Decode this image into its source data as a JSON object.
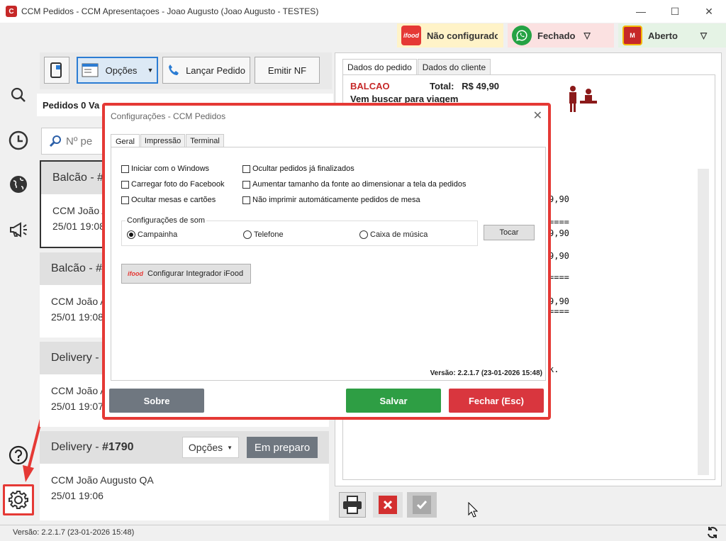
{
  "window": {
    "title": "CCM Pedidos - CCM Apresentaçoes - Joao Augusto (Joao Augusto - TESTES)",
    "minimize": "—",
    "maximize": "☐",
    "close": "✕"
  },
  "status": {
    "ifood": {
      "label": "Não configurado",
      "icon": "ifood",
      "color": "#fff3c8"
    },
    "whatsapp": {
      "label": "Fechado",
      "color": "#fbe1e1"
    },
    "store": {
      "label": "Aberto",
      "color": "#e5f3e5"
    }
  },
  "toolbar": {
    "options_label": "Opções",
    "launch_label": "Lançar Pedido",
    "emit_label": "Emitir NF"
  },
  "orders": {
    "header": "Pedidos 0 Va",
    "search_placeholder": "Nº pe",
    "cards": [
      {
        "title": "Balcão - #",
        "customer": "CCM João A",
        "time": "25/01 19:08"
      },
      {
        "title": "Balcão - #",
        "customer": "CCM João A",
        "time": "25/01 19:08"
      },
      {
        "title": "Delivery -",
        "customer": "CCM João A",
        "time": "25/01 19:07"
      },
      {
        "title_prefix": "Delivery - ",
        "title_num": "#1790",
        "customer": "CCM João Augusto QA",
        "time": "25/01 19:06",
        "options": "Opções",
        "status": "Em preparo"
      }
    ]
  },
  "detail": {
    "tabs": [
      "Dados do pedido",
      "Dados do cliente"
    ],
    "type": "BALCAO",
    "total_label": "Total:",
    "total_value": "R$ 49,90",
    "note": "Vem buscar para viagem",
    "receipt_lines": [
      "9,90",
      "====",
      "9,90",
      "9,90",
      "====",
      "9,90",
      "====",
      "k."
    ]
  },
  "dialog": {
    "title": "Configurações - CCM Pedidos",
    "tabs": [
      "Geral",
      "Impressão",
      "Terminal"
    ],
    "checkboxes": {
      "start_windows": "Iniciar com o Windows",
      "facebook_photo": "Carregar foto do Facebook",
      "hide_tables": "Ocultar mesas e cartões",
      "hide_finished": "Ocultar pedidos já finalizados",
      "increase_font": "Aumentar tamanho da fonte ao dimensionar a tela da pedidos",
      "no_print_table": "Não imprimir automáticamente pedidos de mesa"
    },
    "sound_group": "Configurações de som",
    "sounds": [
      "Campainha",
      "Telefone",
      "Caixa de música"
    ],
    "play_label": "Tocar",
    "ifood_logo": "ifood",
    "ifood_button": "Configurar Integrador iFood",
    "version": "Versão: 2.2.1.7 (23-01-2026 15:48)",
    "about": "Sobre",
    "save": "Salvar",
    "close": "Fechar (Esc)"
  },
  "footer": {
    "version": "Versão: 2.2.1.7 (23-01-2026 15:48)"
  },
  "colors": {
    "highlight": "#e53935",
    "save": "#2e9e44",
    "close": "#d9363e",
    "about": "#6f7780"
  }
}
